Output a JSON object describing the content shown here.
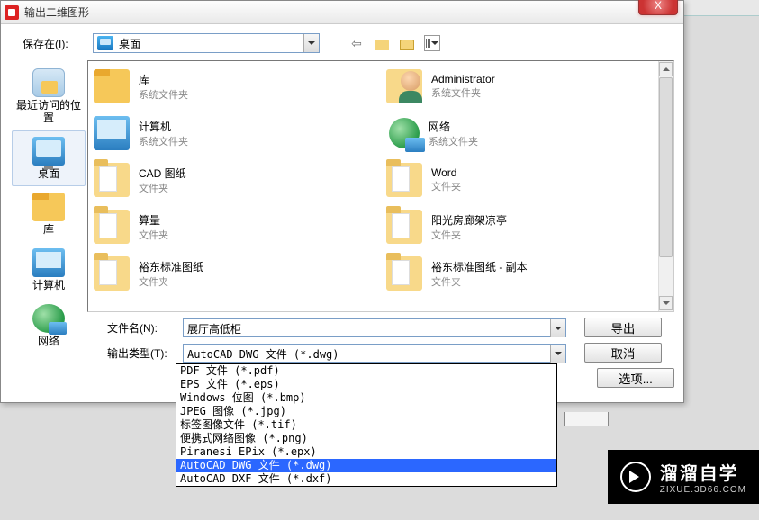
{
  "window": {
    "title": "输出二维图形",
    "close": "X"
  },
  "toolbar": {
    "save_in_label": "保存在(I):",
    "location": "桌面"
  },
  "sidebar": {
    "items": [
      {
        "label": "最近访问的位置"
      },
      {
        "label": "桌面"
      },
      {
        "label": "库"
      },
      {
        "label": "计算机"
      },
      {
        "label": "网络"
      }
    ]
  },
  "files": [
    {
      "name": "库",
      "type": "系统文件夹",
      "icon": "lib"
    },
    {
      "name": "Administrator",
      "type": "系统文件夹",
      "icon": "admin"
    },
    {
      "name": "计算机",
      "type": "系统文件夹",
      "icon": "pc"
    },
    {
      "name": "网络",
      "type": "系统文件夹",
      "icon": "net"
    },
    {
      "name": "CAD 图纸",
      "type": "文件夹",
      "icon": "folder"
    },
    {
      "name": "Word",
      "type": "文件夹",
      "icon": "folder"
    },
    {
      "name": "算量",
      "type": "文件夹",
      "icon": "folder"
    },
    {
      "name": "阳光房廊架凉亭",
      "type": "文件夹",
      "icon": "folder"
    },
    {
      "name": "裕东标准图纸",
      "type": "文件夹",
      "icon": "folder"
    },
    {
      "name": "裕东标准图纸 - 副本",
      "type": "文件夹",
      "icon": "folder"
    }
  ],
  "form": {
    "filename_label": "文件名(N):",
    "filename_value": "展厅高低柜",
    "type_label": "输出类型(T):",
    "type_value": "AutoCAD DWG 文件 (*.dwg)"
  },
  "buttons": {
    "export": "导出",
    "cancel": "取消",
    "options": "选项..."
  },
  "dropdown": {
    "options": [
      "PDF 文件 (*.pdf)",
      "EPS 文件 (*.eps)",
      "Windows 位图 (*.bmp)",
      "JPEG 图像 (*.jpg)",
      "标签图像文件 (*.tif)",
      "便携式网络图像 (*.png)",
      "Piranesi EPix (*.epx)",
      "AutoCAD DWG 文件 (*.dwg)",
      "AutoCAD DXF 文件 (*.dxf)"
    ],
    "selected_index": 7
  },
  "watermark": {
    "big": "溜溜自学",
    "small": "ZIXUE.3D66.COM"
  }
}
